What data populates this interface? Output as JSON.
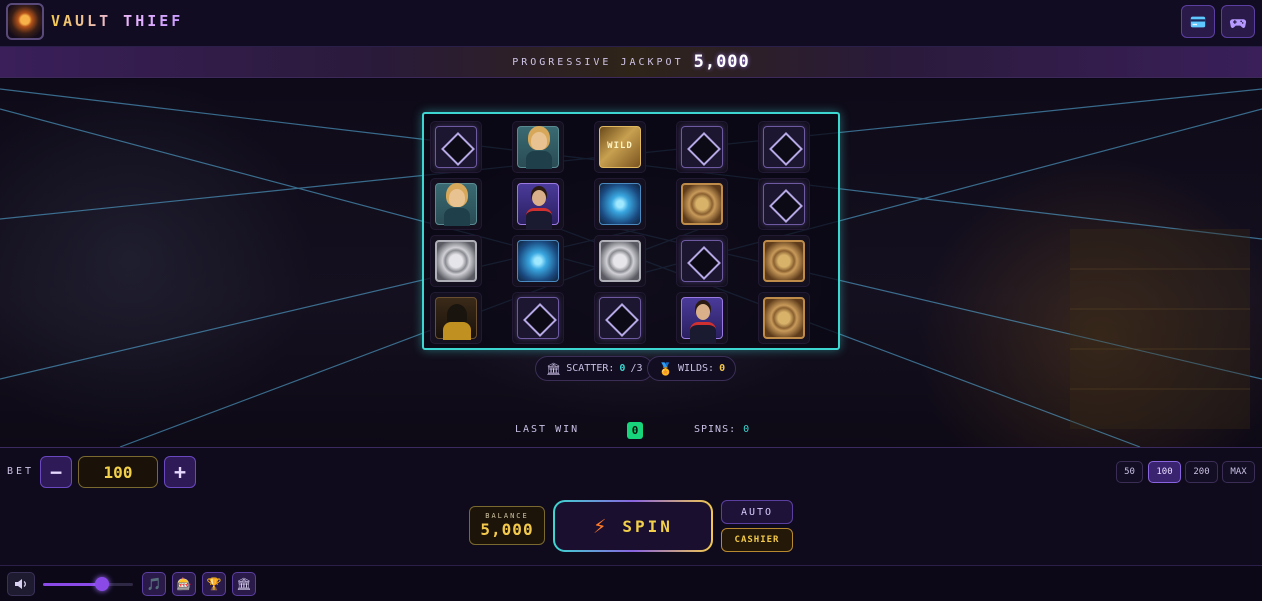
{
  "app": {
    "title": "VAULT THIEF"
  },
  "header": {
    "icons": [
      "card-icon",
      "gamepad-icon"
    ]
  },
  "jackpot": {
    "label": "PROGRESSIVE JACKPOT",
    "value": "5,000"
  },
  "reels": {
    "grid": [
      [
        "diamond",
        "woman",
        "wild",
        "diamond",
        "diamond"
      ],
      [
        "woman",
        "man",
        "blue",
        "gold",
        "diamond"
      ],
      [
        "silver",
        "blue",
        "silver",
        "diamond",
        "gold"
      ],
      [
        "thief",
        "diamond",
        "diamond",
        "man",
        "gold"
      ]
    ],
    "wild_text": "WILD"
  },
  "counters": {
    "scatter": {
      "label": "SCATTER:",
      "value": "0",
      "total": "/3"
    },
    "wilds": {
      "label": "WILDS:",
      "value": "0"
    }
  },
  "stats": {
    "last_win_label": "LAST WIN",
    "last_win_value": "0",
    "spins_label": "SPINS:",
    "spins_value": "0"
  },
  "bet": {
    "label": "BET",
    "value": "100",
    "minus": "−",
    "plus": "+",
    "presets": [
      "50",
      "100",
      "200",
      "MAX"
    ],
    "active_preset": "100"
  },
  "balance": {
    "label": "BALANCE",
    "value": "5,000"
  },
  "actions": {
    "spin": "SPIN",
    "auto": "AUTO",
    "cashier": "CASHIER"
  },
  "audio": {
    "volume_percent": 66
  },
  "colors": {
    "accent": "#8a4ae8",
    "cyan": "#3ed6d0",
    "gold": "#f2c94c"
  }
}
